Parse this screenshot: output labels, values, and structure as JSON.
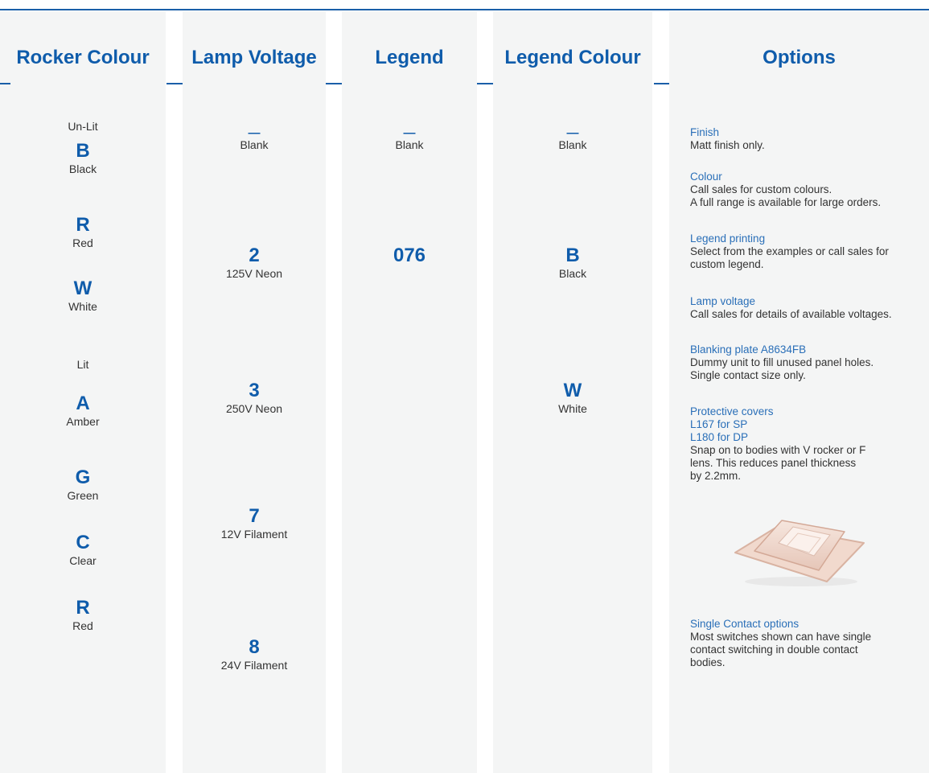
{
  "columns": {
    "rocker": {
      "title": "Rocker Colour",
      "unlit_label": "Un-Lit",
      "lit_label": "Lit",
      "unlit": [
        {
          "code": "B",
          "label": "Black"
        },
        {
          "code": "R",
          "label": "Red"
        },
        {
          "code": "W",
          "label": "White"
        }
      ],
      "lit": [
        {
          "code": "A",
          "label": "Amber"
        },
        {
          "code": "G",
          "label": "Green"
        },
        {
          "code": "C",
          "label": "Clear"
        },
        {
          "code": "R",
          "label": "Red"
        }
      ]
    },
    "lamp": {
      "title": "Lamp Voltage",
      "items": [
        {
          "code": "—",
          "label": "Blank"
        },
        {
          "code": "2",
          "label": "125V Neon"
        },
        {
          "code": "3",
          "label": "250V Neon"
        },
        {
          "code": "7",
          "label": "12V Filament"
        },
        {
          "code": "8",
          "label": "24V Filament"
        }
      ]
    },
    "legend": {
      "title": "Legend",
      "items": [
        {
          "code": "—",
          "label": "Blank"
        },
        {
          "code": "076",
          "label": ""
        }
      ]
    },
    "legend_colour": {
      "title": "Legend Colour",
      "items": [
        {
          "code": "—",
          "label": "Blank"
        },
        {
          "code": "B",
          "label": "Black"
        },
        {
          "code": "W",
          "label": "White"
        }
      ]
    },
    "options": {
      "title": "Options",
      "finish": {
        "title": "Finish",
        "text": "Matt finish only."
      },
      "colour": {
        "title": "Colour",
        "line1": "Call sales for custom colours.",
        "line2": "A full range is available for large orders."
      },
      "legend_printing": {
        "title": "Legend printing",
        "line1": "Select from the examples or call sales for",
        "line2": "custom legend."
      },
      "lamp_voltage": {
        "title": "Lamp voltage",
        "text": "Call sales for details of available voltages."
      },
      "blanking": {
        "title": "Blanking plate A8634FB",
        "line1": "Dummy unit to fill unused panel holes.",
        "line2": "Single contact size only."
      },
      "covers": {
        "title": "Protective covers",
        "line2": "L167 for SP",
        "line3": "L180 for DP",
        "text1": "Snap on to bodies with V rocker or F",
        "text2": "lens. This reduces panel thickness",
        "text3": "by 2.2mm."
      },
      "single": {
        "title": "Single Contact options",
        "line1": "Most switches shown can have single",
        "line2": "contact switching in double contact",
        "line3": "bodies."
      }
    }
  },
  "colors": {
    "accent": "#0f5cab",
    "panel": "#f4f5f5"
  }
}
